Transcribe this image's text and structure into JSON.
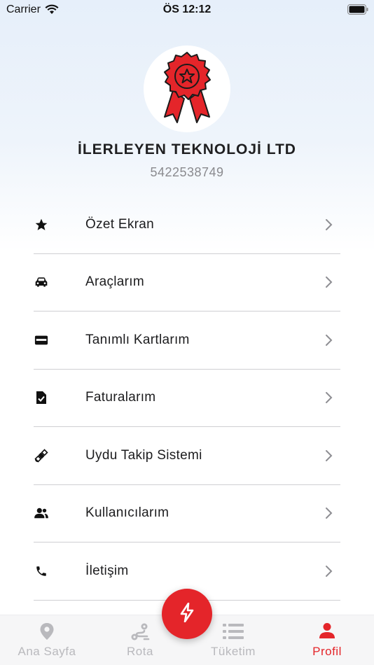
{
  "status_bar": {
    "carrier": "Carrier",
    "time": "ÖS 12:12"
  },
  "profile": {
    "company_name": "İLERLEYEN TEKNOLOJİ LTD",
    "phone": "5422538749"
  },
  "menu": {
    "items": [
      {
        "label": "Özet Ekran",
        "icon": "star-icon"
      },
      {
        "label": "Araçlarım",
        "icon": "car-icon"
      },
      {
        "label": "Tanımlı Kartlarım",
        "icon": "credit-card-icon"
      },
      {
        "label": "Faturalarım",
        "icon": "invoice-icon"
      },
      {
        "label": "Uydu Takip Sistemi",
        "icon": "satellite-icon"
      },
      {
        "label": "Kullanıcılarım",
        "icon": "users-icon"
      },
      {
        "label": "İletişim",
        "icon": "phone-icon"
      }
    ]
  },
  "tabbar": {
    "tabs": [
      {
        "label": "Ana Sayfa",
        "icon": "location-pin-icon"
      },
      {
        "label": "Rota",
        "icon": "route-icon"
      },
      {
        "label": "Tüketim",
        "icon": "list-icon"
      },
      {
        "label": "Profil",
        "icon": "person-icon",
        "active": true
      }
    ],
    "fab_icon": "lightning-icon"
  },
  "colors": {
    "accent": "#e4252a",
    "inactive": "#b9b9bd"
  }
}
